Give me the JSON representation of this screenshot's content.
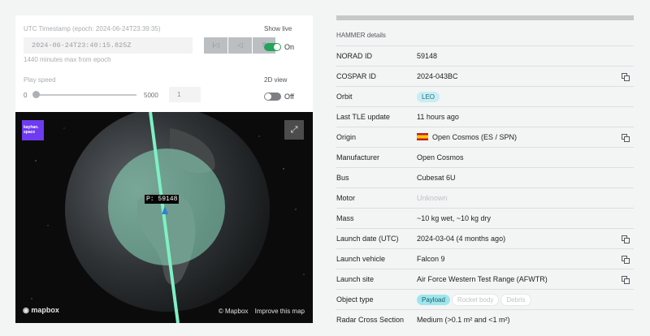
{
  "controls": {
    "timestamp_label": "UTC Timestamp (epoch: 2024-06-24T23:39:35)",
    "timestamp_value": "2024-06-24T23:40:15.825Z",
    "timestamp_hint": "1440 minutes max from epoch",
    "play_buttons": [
      {
        "name": "skip-back",
        "glyph": "|◁"
      },
      {
        "name": "play-back",
        "glyph": "◁"
      },
      {
        "name": "pause",
        "glyph": "II"
      }
    ],
    "show_live_label": "Show live",
    "show_live_state": "On",
    "play_speed_label": "Play speed",
    "speed_min": "0",
    "speed_max": "5000",
    "speed_value": "1",
    "speed_fraction": 0,
    "view_2d_label": "2D view",
    "view_2d_state": "Off"
  },
  "map": {
    "logo_text": "kayhan. space",
    "satellite_label": "P: 59148",
    "mapbox_label": "mapbox",
    "attribution": "© Mapbox",
    "improve_link": "Improve this map",
    "fullscreen_icon": "expand-icon"
  },
  "details": {
    "title": "HAMMER details",
    "rows": [
      {
        "key": "NORAD ID",
        "value": "59148",
        "copy": false
      },
      {
        "key": "COSPAR ID",
        "value": "2024-043BC",
        "copy": true
      },
      {
        "key": "Orbit",
        "value": "LEO",
        "pill": true,
        "copy": false
      },
      {
        "key": "Last TLE update",
        "value": "11 hours ago",
        "copy": false
      },
      {
        "key": "Origin",
        "value": "Open Cosmos (ES / SPN)",
        "flag": "spain-flag-icon",
        "copy": true
      },
      {
        "key": "Manufacturer",
        "value": "Open Cosmos",
        "copy": false
      },
      {
        "key": "Bus",
        "value": "Cubesat 6U",
        "copy": false
      },
      {
        "key": "Motor",
        "value": "Unknown",
        "muted": true,
        "copy": false
      },
      {
        "key": "Mass",
        "value": "~10 kg wet, ~10 kg dry",
        "copy": false
      },
      {
        "key": "Launch date (UTC)",
        "value": "2024-03-04 (4 months ago)",
        "copy": true
      },
      {
        "key": "Launch vehicle",
        "value": "Falcon 9",
        "copy": true
      },
      {
        "key": "Launch site",
        "value": "Air Force Western Test Range (AFWTR)",
        "copy": true
      },
      {
        "key": "Object type",
        "chips": [
          "Payload",
          "Rocket body",
          "Debris"
        ],
        "active_chip": 0,
        "copy": false
      },
      {
        "key": "Radar Cross Section",
        "value": "Medium (>0.1 m² and <1 m²)",
        "copy": false
      }
    ]
  }
}
